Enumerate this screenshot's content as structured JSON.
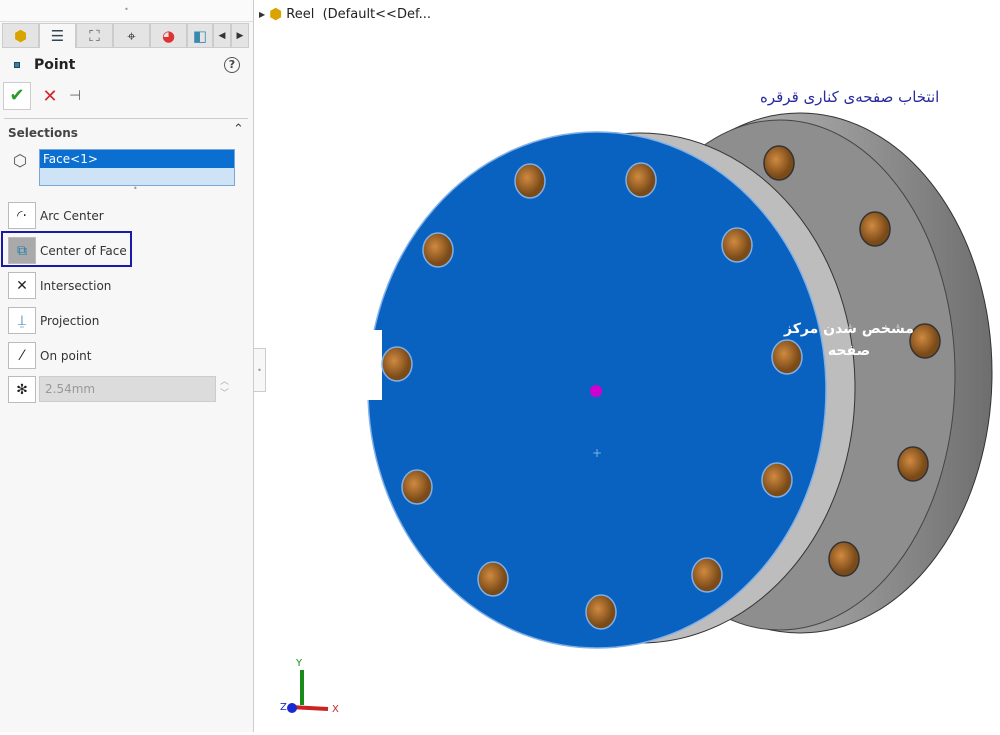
{
  "panel": {
    "tabs": [
      "part-icon",
      "property-manager-icon",
      "configuration-icon",
      "dimxpert-icon",
      "appearance-icon",
      "display-icon"
    ],
    "title": "Point",
    "help": "?",
    "ok": "✔",
    "cancel": "✕",
    "pin": "⊣",
    "selections_label": "Selections",
    "selection": "Face<1>",
    "options": [
      "Arc Center",
      "Center of Face",
      "Intersection",
      "Projection",
      "On point"
    ],
    "selected_option": "Center of Face",
    "distance": "2.54mm"
  },
  "tree": {
    "item": "Reel  (Default<<Def..."
  },
  "viewport": {
    "caption": "انتخاب صفحه‌ی کناری قرقره",
    "annotation_line1": "مشخص شدن مرکز",
    "annotation_line2": "صفحه",
    "axes": {
      "x": "X",
      "y": "Y",
      "z": "Z"
    },
    "face_color": "#0a62c0",
    "highlight_color": "#1a1aa8",
    "point_color": "#d000d0"
  }
}
